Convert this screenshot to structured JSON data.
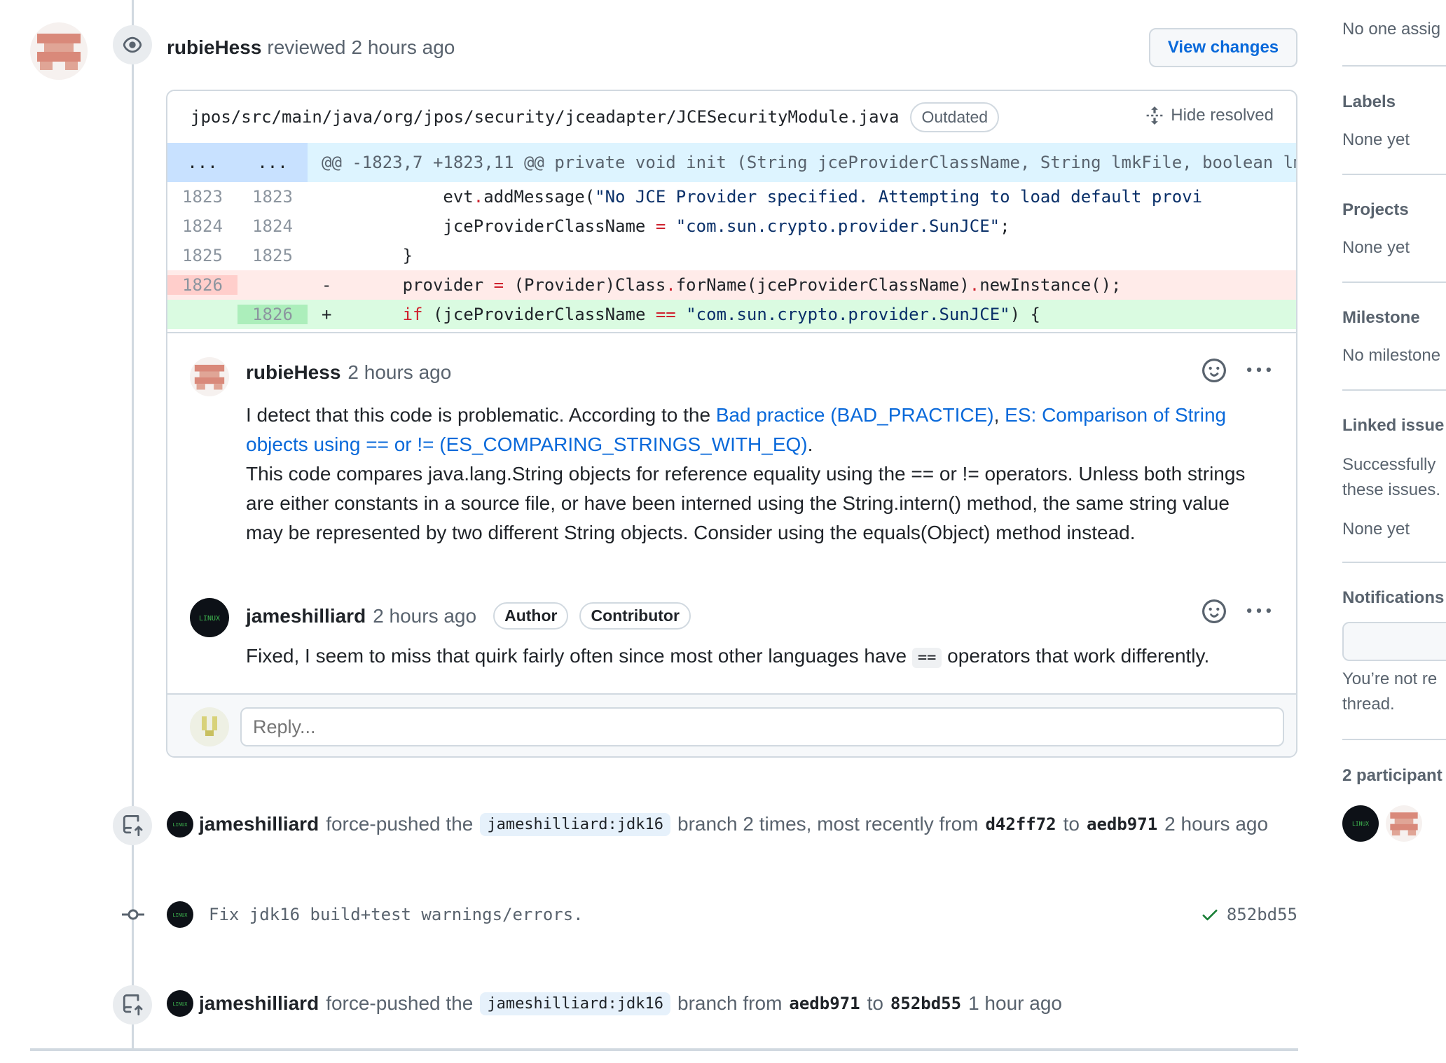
{
  "review": {
    "user": "rubieHess",
    "action": "reviewed",
    "time": "2 hours ago",
    "view_changes_label": "View changes"
  },
  "file": {
    "path": "jpos/src/main/java/org/jpos/security/jceadapter/JCESecurityModule.java",
    "badge": "Outdated",
    "hide_resolved_label": "Hide resolved",
    "hunk_left": "...",
    "hunk_right": "...",
    "hunk_text": "@@ -1823,7 +1823,11 @@ private void init (String jceProviderClassName, String lmkFile, boolean lm",
    "lines": [
      {
        "old": "1823",
        "new": "1823",
        "sign": " ",
        "text": "            evt.addMessage(\"No JCE Provider specified. Attempting to load default provi"
      },
      {
        "old": "1824",
        "new": "1824",
        "sign": " ",
        "text": "            jceProviderClassName = \"com.sun.crypto.provider.SunJCE\";"
      },
      {
        "old": "1825",
        "new": "1825",
        "sign": " ",
        "text": "        }"
      },
      {
        "old": "1826",
        "new": "",
        "sign": "-",
        "text": "        provider = (Provider)Class.forName(jceProviderClassName).newInstance();"
      },
      {
        "old": "",
        "new": "1826",
        "sign": "+",
        "text": "        if (jceProviderClassName == \"com.sun.crypto.provider.SunJCE\") {"
      }
    ]
  },
  "comment1": {
    "user": "rubieHess",
    "time": "2 hours ago",
    "intro": "I detect that this code is problematic. According to the ",
    "link1": "Bad practice (BAD_PRACTICE)",
    "sep": ", ",
    "link2": "ES: Comparison of String objects using == or != (ES_COMPARING_STRINGS_WITH_EQ)",
    "end": ".",
    "body": "This code compares java.lang.String objects for reference equality using the == or != operators. Unless both strings are either constants in a source file, or have been interned using the String.intern() method, the same string value may be represented by two different String objects. Consider using the equals(Object) method instead."
  },
  "comment2": {
    "user": "jameshilliard",
    "time": "2 hours ago",
    "badge_author": "Author",
    "badge_contributor": "Contributor",
    "text_before": "Fixed, I seem to miss that quirk fairly often since most other languages have ",
    "code": "==",
    "text_after": " operators that work differently."
  },
  "reply": {
    "placeholder": "Reply..."
  },
  "events": {
    "push1": {
      "user": "jameshilliard",
      "pre": "force-pushed the",
      "branch": "jameshilliard:jdk16",
      "mid": "branch 2 times, most recently from",
      "from_sha": "d42ff72",
      "to": "to",
      "to_sha": "aedb971",
      "time": "2 hours ago"
    },
    "commit": {
      "message": "Fix jdk16 build+test warnings/errors.",
      "sha": "852bd55"
    },
    "push2": {
      "user": "jameshilliard",
      "pre": "force-pushed the",
      "branch": "jameshilliard:jdk16",
      "mid": "branch from",
      "from_sha": "aedb971",
      "to": "to",
      "to_sha": "852bd55",
      "time": "1 hour ago"
    }
  },
  "sidebar": {
    "assignees_value": "No one assig",
    "labels_title": "Labels",
    "labels_value": "None yet",
    "projects_title": "Projects",
    "projects_value": "None yet",
    "milestone_title": "Milestone",
    "milestone_value": "No milestone",
    "linked_title": "Linked issue",
    "linked_desc1": "Successfully",
    "linked_desc2": "these issues.",
    "linked_value": "None yet",
    "notifications_title": "Notifications",
    "notifications_desc1": "You’re not re",
    "notifications_desc2": "thread.",
    "participants_title": "2 participant"
  },
  "colors": {
    "link": "#0969da",
    "deletion_bg": "#ffebe9",
    "addition_bg": "#dafbe1",
    "hunk_bg": "#ddf4ff",
    "success": "#1a7f37"
  }
}
